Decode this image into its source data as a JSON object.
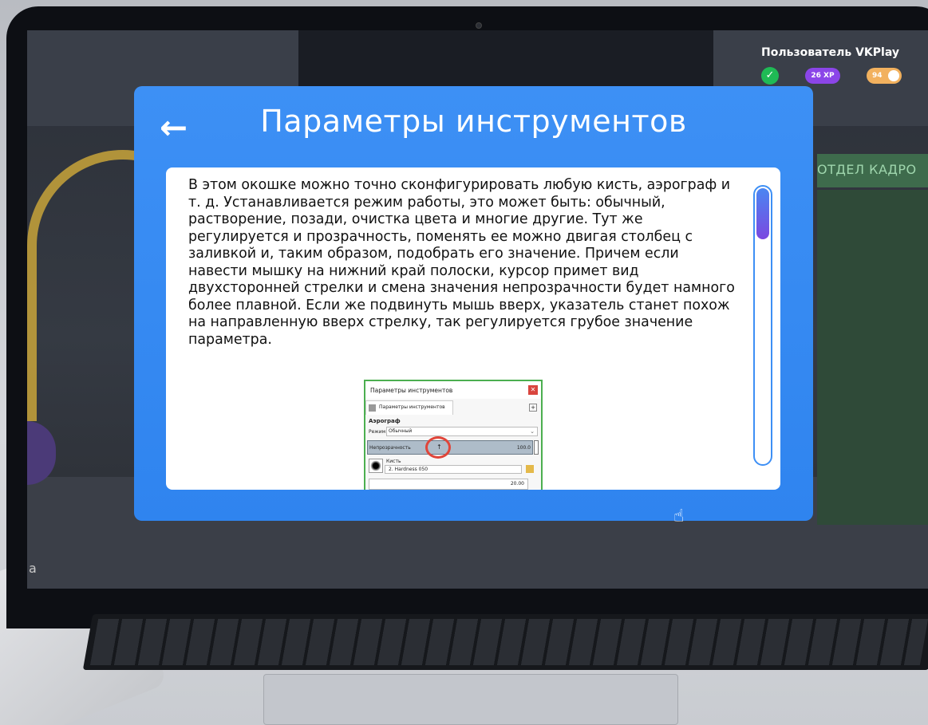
{
  "hud": {
    "username": "Пользователь VKPlay",
    "xp": "26 XP",
    "coins": "94"
  },
  "modal": {
    "back_label": "←",
    "title": "Параметры инструментов",
    "body": "В этом окошке можно точно сконфигурировать любую кисть, аэрограф и т. д. Устанавливается режим работы, это может быть: обычный, растворение, позади, очистка цвета и многие другие. Тут же регулируется и прозрачность, поменять ее можно двигая столбец с заливкой и, таким образом, подобрать его значение. Причем если навести мышку на нижний край полоски, курсор примет вид двухсторонней стрелки и смена значения непрозрачности будет намного более плавной. Если же подвинуть мышь вверх, указатель станет похож на направленную вверх стрелку, так регулируется грубое значение параметра."
  },
  "embed": {
    "window_title": "Параметры инструментов",
    "tab_label": "Параметры инструментов",
    "group_label": "Аэрограф",
    "mode_label": "Режим",
    "mode_value": "Обычный",
    "opacity_label": "Непрозрачность",
    "opacity_value": "100.0",
    "brush_label": "Кисть",
    "brush_value": "2. Hardness 050",
    "size_value": "20.00"
  },
  "background": {
    "sign_text": "ОТДЕЛ КАДРО",
    "corner_letter": "a"
  },
  "colors": {
    "modal_blue": "#3d90f5",
    "xp_purple": "#8b45e8",
    "coin_orange": "#f2b15e",
    "check_green": "#1fba55"
  }
}
